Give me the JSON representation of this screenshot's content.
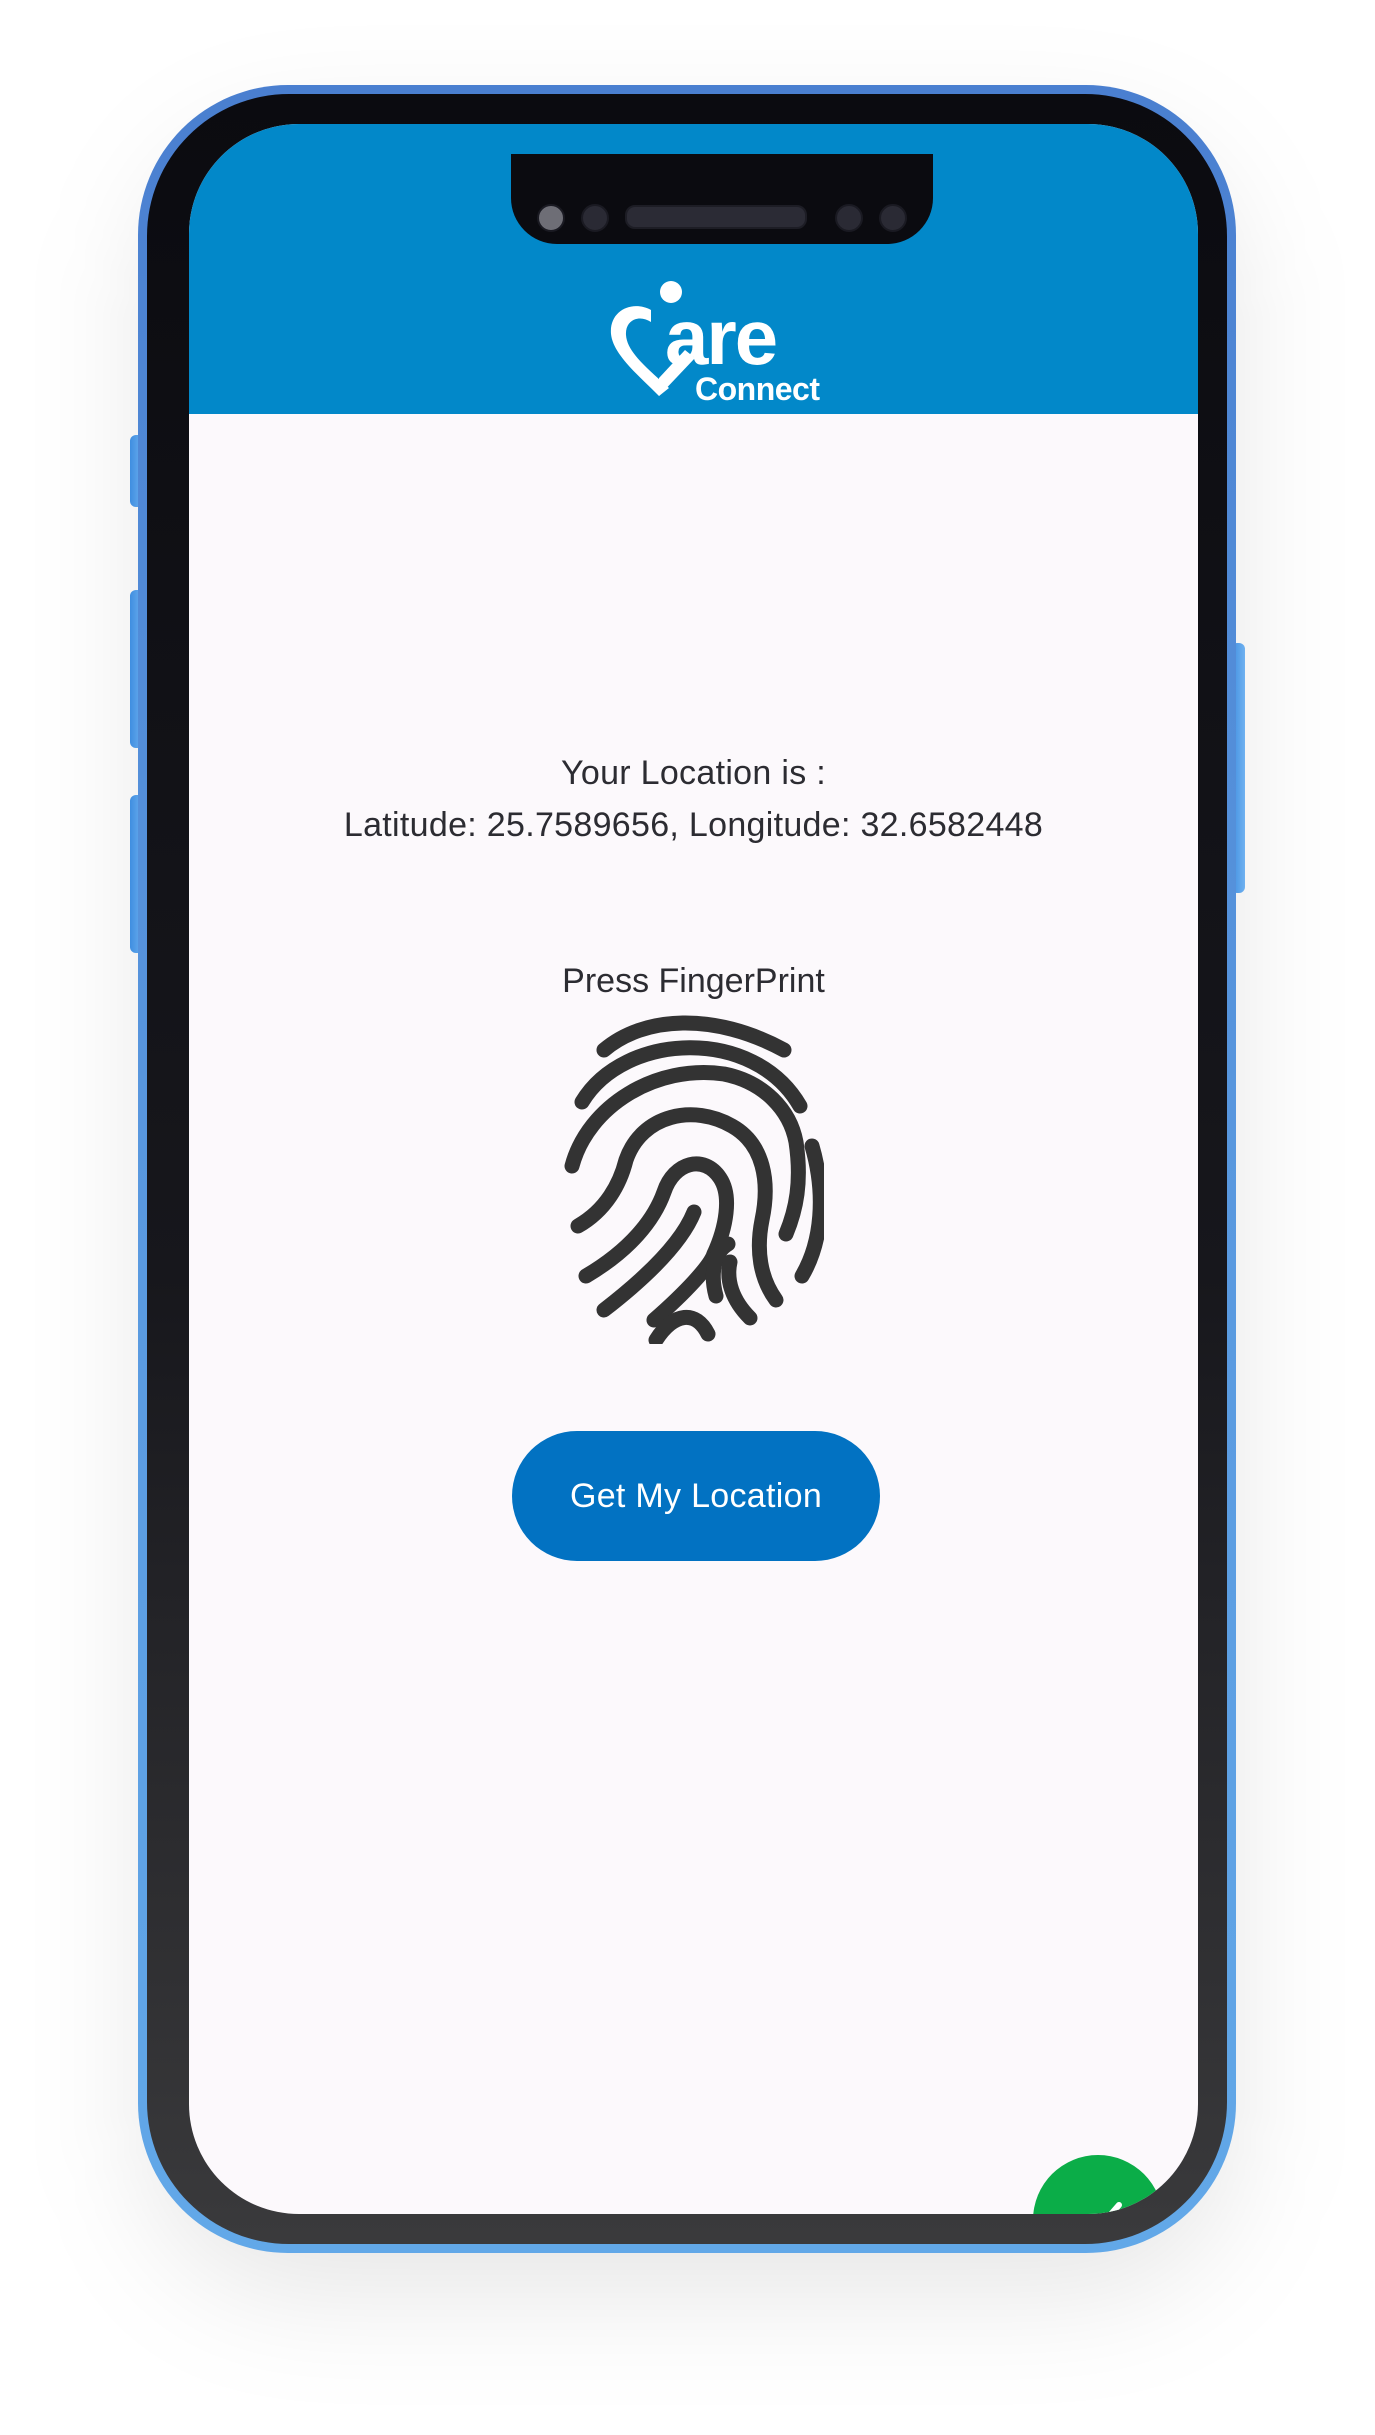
{
  "app": {
    "brand_logo_text": "Care Connect",
    "header_color": "#0288c9"
  },
  "location": {
    "title": "Your Location is :",
    "coordinates": "Latitude: 25.7589656, Longitude: 32.6582448"
  },
  "fingerprint": {
    "label": "Press FingerPrint",
    "icon": "fingerprint-icon"
  },
  "actions": {
    "get_location_label": "Get My Location",
    "get_location_color": "#0272c2",
    "confirm_icon": "check-icon",
    "confirm_color": "#0bad48"
  }
}
